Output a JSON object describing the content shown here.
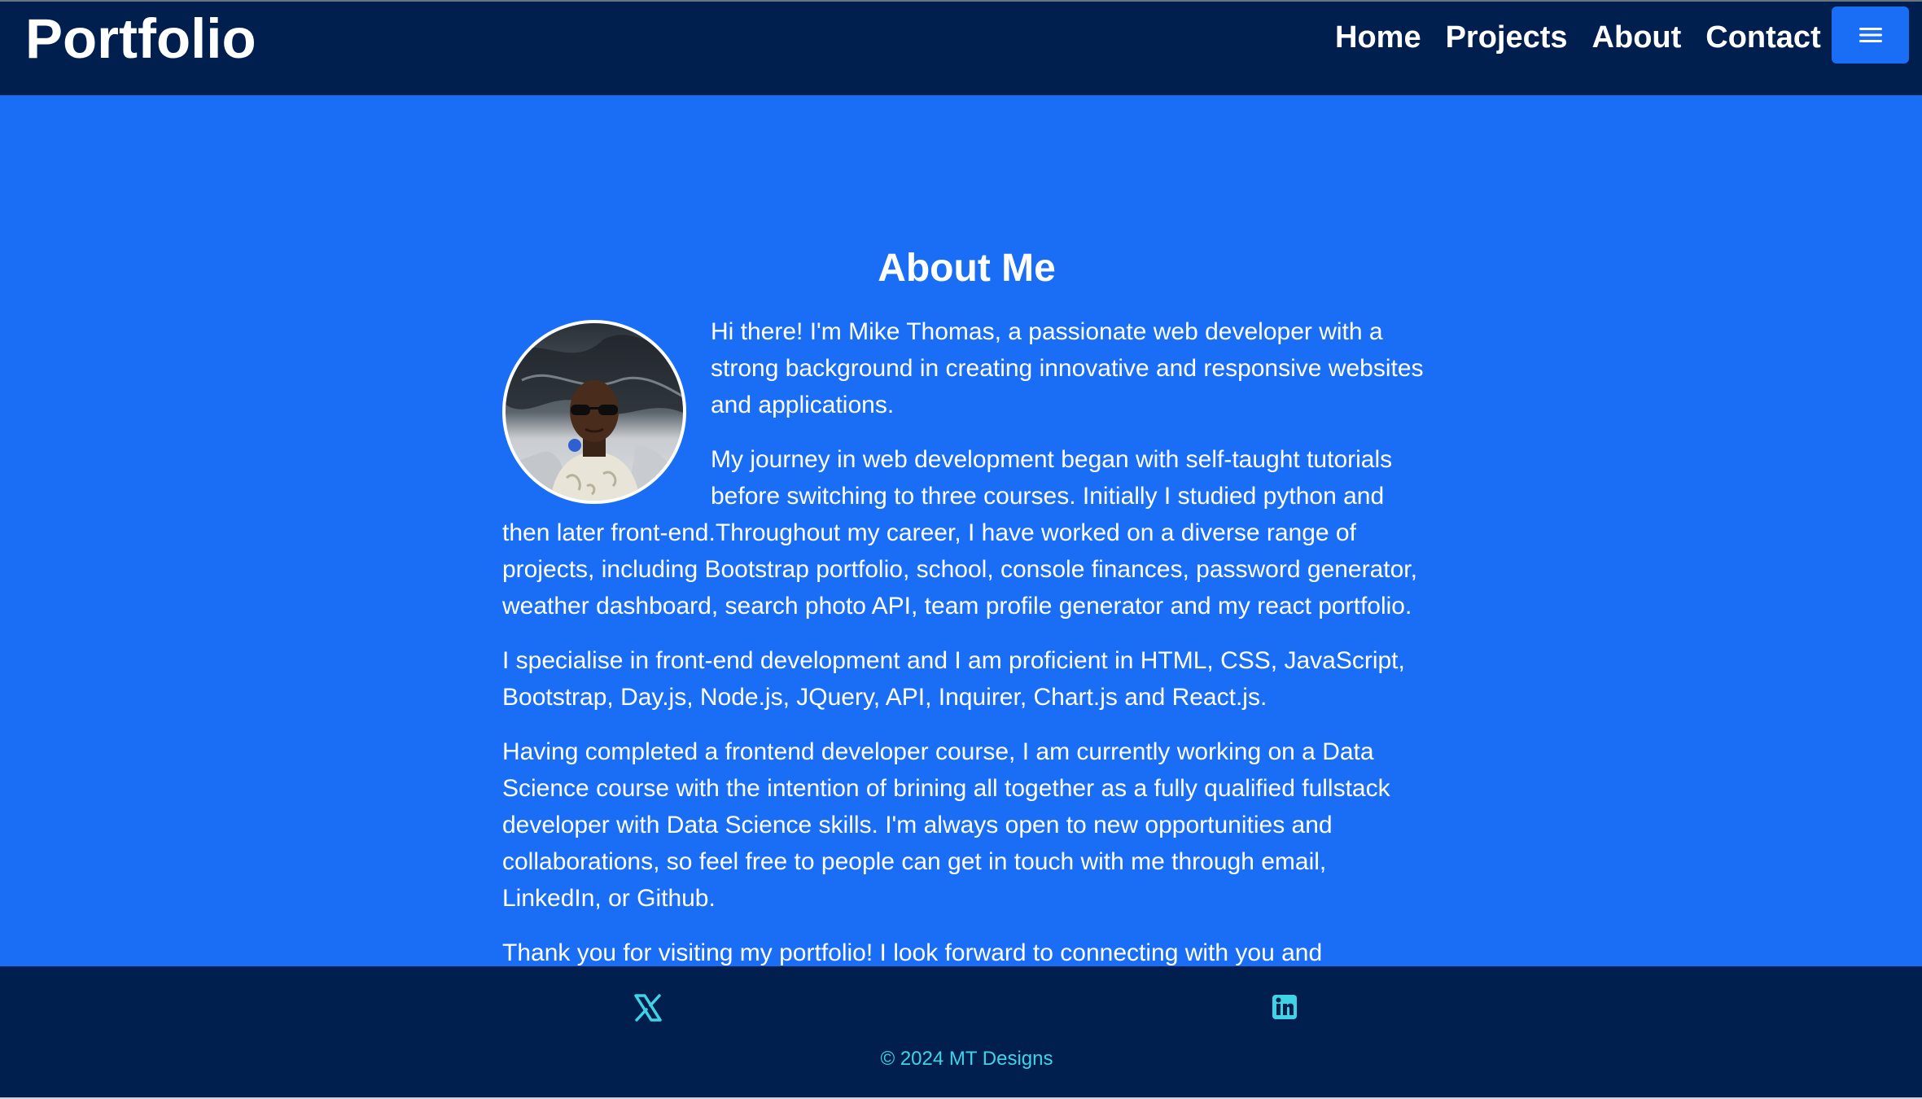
{
  "navbar": {
    "brand": "Portfolio",
    "links": [
      "Home",
      "Projects",
      "About",
      "Contact"
    ],
    "toggle_icon": "hamburger-menu-icon"
  },
  "about": {
    "title": "About Me",
    "avatar_icon": "profile-photo",
    "paragraphs": [
      "Hi there! I'm Mike Thomas, a passionate web developer with a strong background in creating innovative and responsive websites and applications.",
      "My journey in web development began with self-taught tutorials before switching to three courses. Initially I studied python and then later front-end.Throughout my career, I have worked on a diverse range of projects, including Bootstrap portfolio, school, console finances, password generator, weather dashboard, search photo API, team profile generator and my react portfolio.",
      "I specialise in front-end development and I am proficient in HTML, CSS, JavaScript, Bootstrap, Day.js, Node.js, JQuery, API, Inquirer, Chart.js and React.js.",
      "Having completed a frontend developer course, I am currently working on a Data Science course with the intention of brining all together as a fully qualified fullstack developer with Data Science skills. I'm always open to new opportunities and collaborations, so feel free to people can get in touch with me through email, LinkedIn, or Github.",
      "Thank you for visiting my portfolio! I look forward to connecting with you and discussing how we can work together to bring your web development projects to life."
    ]
  },
  "footer": {
    "social": [
      "x-twitter-icon",
      "linkedin-icon"
    ],
    "copyright": "© 2024 MT Designs"
  },
  "colors": {
    "navbar_bg": "#001f4f",
    "main_bg": "#1a6ef6",
    "accent": "#3fd3e6",
    "text": "#ffffff"
  }
}
